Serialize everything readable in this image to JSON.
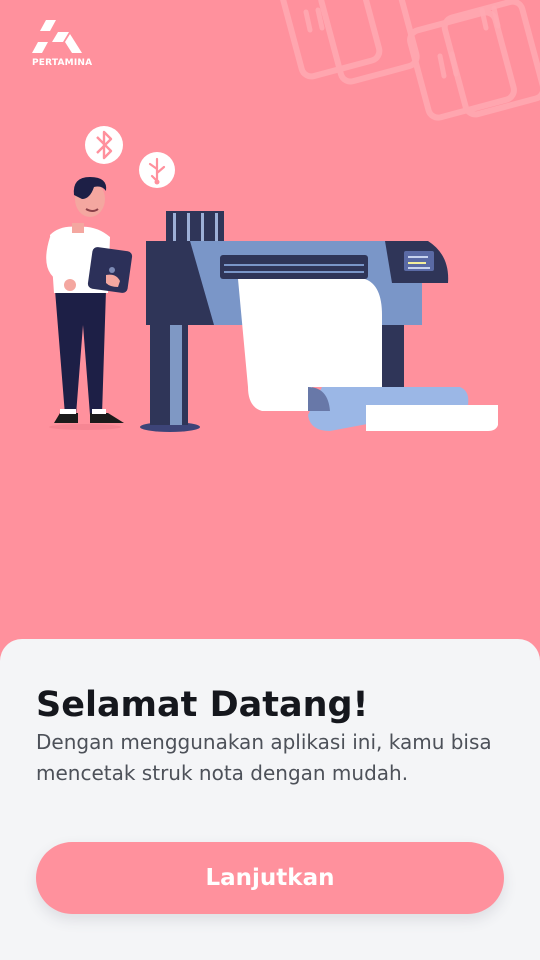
{
  "brand": {
    "name": "PERTAMINA",
    "logo_icon": "pertamina-logo-icon"
  },
  "welcome": {
    "title": "Selamat Datang!",
    "description": "Dengan menggunakan aplikasi ini, kamu bisa mencetak struk nota dengan mudah."
  },
  "actions": {
    "continue_label": "Lanjutkan"
  },
  "colors": {
    "background": "#ff919d",
    "sheet": "#f4f5f7",
    "button": "#ff919d",
    "title_text": "#15171d",
    "body_text": "#4d5159"
  },
  "illustration_icons": [
    "bluetooth-icon",
    "usb-icon",
    "person-with-tablet",
    "large-format-printer"
  ]
}
